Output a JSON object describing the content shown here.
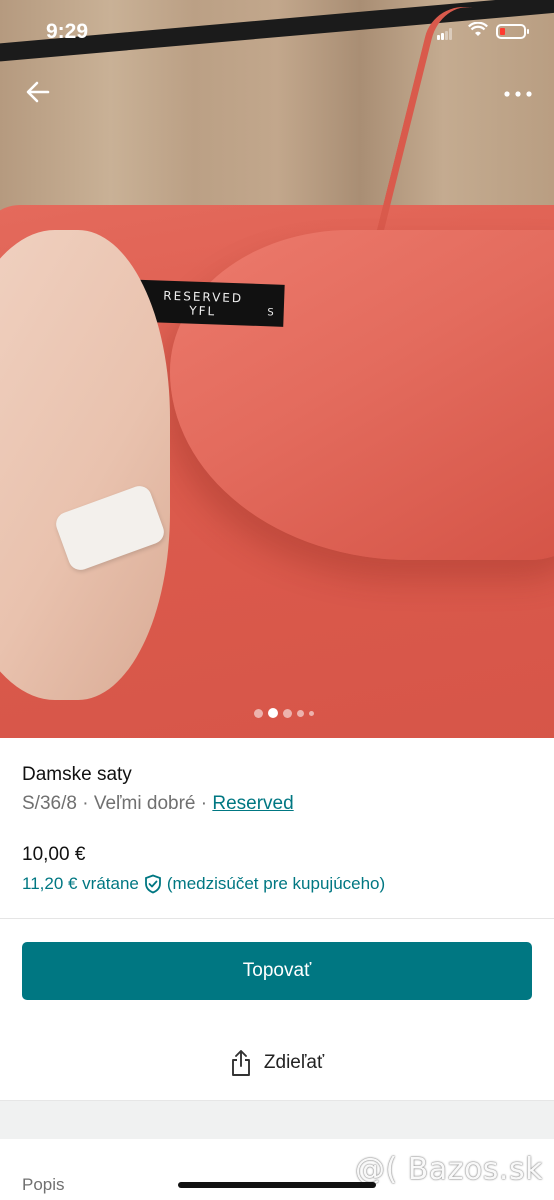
{
  "status_bar": {
    "time": "9:29"
  },
  "photo": {
    "label_brand_line1": "RESERVED",
    "label_brand_line2": "YFL",
    "label_size": "S",
    "page_indicator": {
      "total": 5,
      "active_index": 1
    }
  },
  "nav": {
    "back_icon": "arrow-left-icon",
    "more_icon": "more-dots-icon"
  },
  "item": {
    "title": "Damske saty",
    "meta": "S/36/8 · Veľmi dobré · ",
    "brand": "Reserved",
    "price": "10,00 €",
    "price_with_fee": "11,20 € vrátane",
    "price_note": "(medzisúčet pre kupujúceho)"
  },
  "actions": {
    "bump_label": "Topovať",
    "share_label": "Zdieľať"
  },
  "section": {
    "description_label": "Popis"
  },
  "watermark": "@( Bazos.sk",
  "colors": {
    "accent": "#007782",
    "text": "#111111",
    "muted": "#707070"
  }
}
